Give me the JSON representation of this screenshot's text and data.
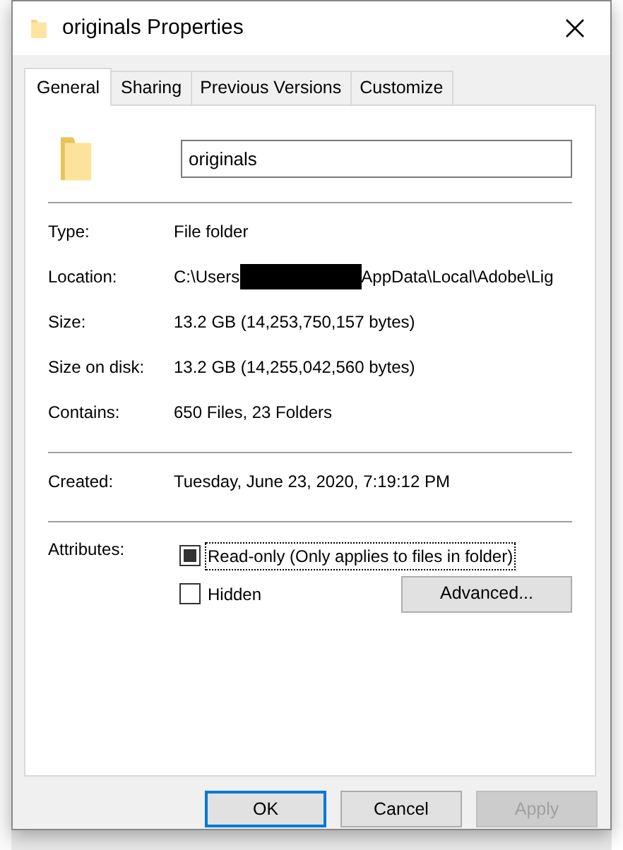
{
  "window": {
    "title": "originals Properties"
  },
  "tabs": [
    {
      "label": "General",
      "selected": true
    },
    {
      "label": "Sharing",
      "selected": false
    },
    {
      "label": "Previous Versions",
      "selected": false
    },
    {
      "label": "Customize",
      "selected": false
    }
  ],
  "name_field": {
    "value": "originals"
  },
  "groups": [
    {
      "rows": [
        {
          "label": "Type:",
          "value": "File folder"
        },
        {
          "label": "Location:",
          "value": "C:\\Users",
          "redacted": true,
          "value_after": "AppData\\Local\\Adobe\\Lig"
        },
        {
          "label": "Size:",
          "value": "13.2 GB (14,253,750,157 bytes)"
        },
        {
          "label": "Size on disk:",
          "value": "13.2 GB (14,255,042,560 bytes)"
        },
        {
          "label": "Contains:",
          "value": "650 Files, 23 Folders"
        }
      ]
    },
    {
      "rows": [
        {
          "label": "Created:",
          "value": "Tuesday, June 23, 2020, 7:19:12 PM"
        }
      ]
    }
  ],
  "attributes": {
    "label": "Attributes:",
    "checkboxes": [
      {
        "label": "Read-only (Only applies to files in folder)",
        "checked": false,
        "indeterminate": true,
        "focused": true
      },
      {
        "label": "Hidden",
        "checked": false,
        "indeterminate": false,
        "focused": false
      }
    ],
    "advanced_button": "Advanced..."
  },
  "buttons": [
    {
      "label": "OK",
      "default": true,
      "disabled": false
    },
    {
      "label": "Cancel",
      "default": false,
      "disabled": false
    },
    {
      "label": "Apply",
      "default": false,
      "disabled": true
    }
  ]
}
